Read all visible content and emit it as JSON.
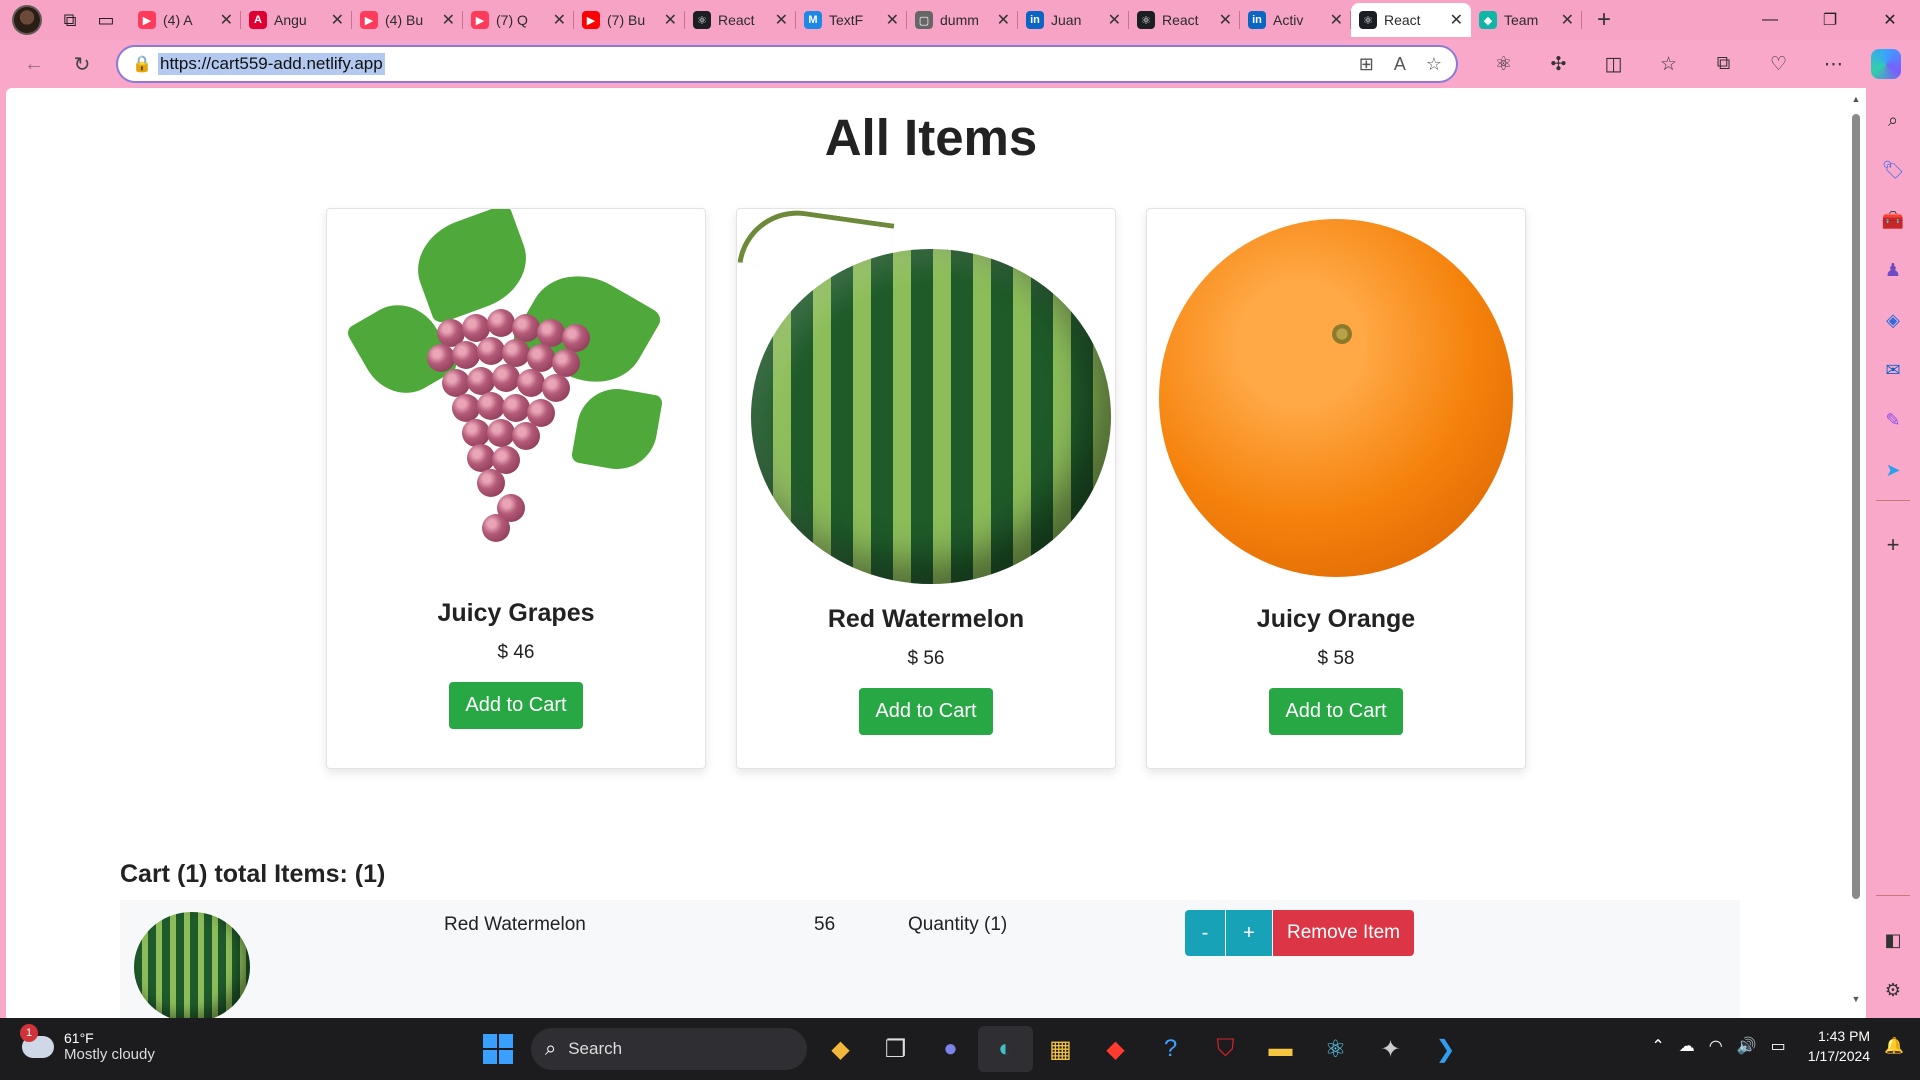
{
  "browser": {
    "tabs": [
      {
        "title": "(4) A",
        "fav": "▶",
        "color": "#ff3b5c"
      },
      {
        "title": "Angu",
        "fav": "A",
        "color": "#dd0031"
      },
      {
        "title": "(4) Bu",
        "fav": "▶",
        "color": "#ff3b5c"
      },
      {
        "title": "(7) Q",
        "fav": "▶",
        "color": "#ff3b5c"
      },
      {
        "title": "(7) Bu",
        "fav": "▶",
        "color": "#ff0000"
      },
      {
        "title": "React",
        "fav": "⚛",
        "color": "#1b1f24"
      },
      {
        "title": "TextF",
        "fav": "M",
        "color": "#1e88e5"
      },
      {
        "title": "dumm",
        "fav": "▢",
        "color": "#666666"
      },
      {
        "title": "Juan",
        "fav": "in",
        "color": "#0a66c2"
      },
      {
        "title": "React",
        "fav": "⚛",
        "color": "#1b1f24"
      },
      {
        "title": "Activ",
        "fav": "in",
        "color": "#0a66c2"
      },
      {
        "title": "React",
        "fav": "⚛",
        "color": "#1b1f24",
        "active": true
      },
      {
        "title": "Team",
        "fav": "◆",
        "color": "#11b5a5"
      }
    ],
    "url": "https://cart559-add.netlify.app"
  },
  "page": {
    "title": "All Items",
    "products": [
      {
        "name": "Juicy Grapes",
        "price": "$ 46",
        "button": "Add to Cart"
      },
      {
        "name": "Red Watermelon",
        "price": "$ 56",
        "button": "Add to Cart"
      },
      {
        "name": "Juicy Orange",
        "price": "$ 58",
        "button": "Add to Cart"
      }
    ],
    "cart": {
      "heading": "Cart (1) total Items: (1)",
      "items": [
        {
          "name": "Red Watermelon",
          "price": "56",
          "quantity": "Quantity (1)",
          "minus": "-",
          "plus": "+",
          "remove": "Remove Item"
        }
      ]
    }
  },
  "taskbar": {
    "weather_badge": "1",
    "temperature": "61°F",
    "weather": "Mostly cloudy",
    "search_label": "Search",
    "time": "1:43 PM",
    "date": "1/17/2024"
  },
  "colors": {
    "accent_pink": "#f9a8c9",
    "add_green": "#28a745",
    "qty_teal": "#17a2b8",
    "remove_red": "#dc3545"
  }
}
